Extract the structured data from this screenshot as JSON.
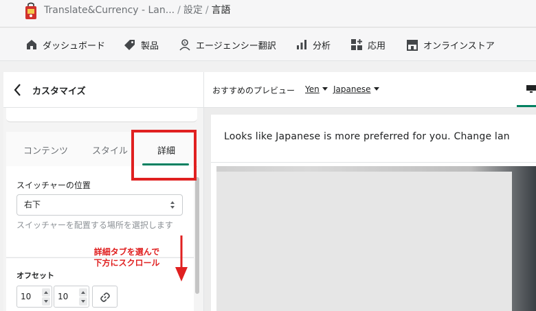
{
  "breadcrumb": {
    "app_name": "Translate&Currency - Lan...",
    "separator": "/",
    "settings": "設定",
    "current": "言語"
  },
  "nav": {
    "items": [
      {
        "label": "ダッシュボード",
        "icon": "home-icon"
      },
      {
        "label": "製品",
        "icon": "tag-icon"
      },
      {
        "label": "エージェンシー翻訳",
        "icon": "agency-translate-icon"
      },
      {
        "label": "分析",
        "icon": "bar-chart-icon"
      },
      {
        "label": "応用",
        "icon": "apps-icon"
      },
      {
        "label": "オンラインストア",
        "icon": "store-icon"
      }
    ]
  },
  "panel": {
    "title": "カスタマイズ",
    "tabs": [
      {
        "label": "コンテンツ",
        "active": false
      },
      {
        "label": "スタイル",
        "active": false
      },
      {
        "label": "詳細",
        "active": true
      }
    ],
    "switcher_position_label": "スイッチャーの位置",
    "switcher_position_value": "右下",
    "switcher_position_help": "スイッチャーを配置する場所を選択します",
    "offset_label": "オフセット",
    "offset_x": "10",
    "offset_y": "10"
  },
  "annotation": {
    "line1": "詳細タブを選んで",
    "line2": "下方にスクロール",
    "color": "#e02020"
  },
  "preview": {
    "label": "おすすめのプレビュー",
    "currency": "Yen",
    "language": "Japanese",
    "banner_text": "Looks like Japanese is more preferred for you. Change lan"
  },
  "colors": {
    "accent": "#008060",
    "highlight": "#e02020"
  }
}
